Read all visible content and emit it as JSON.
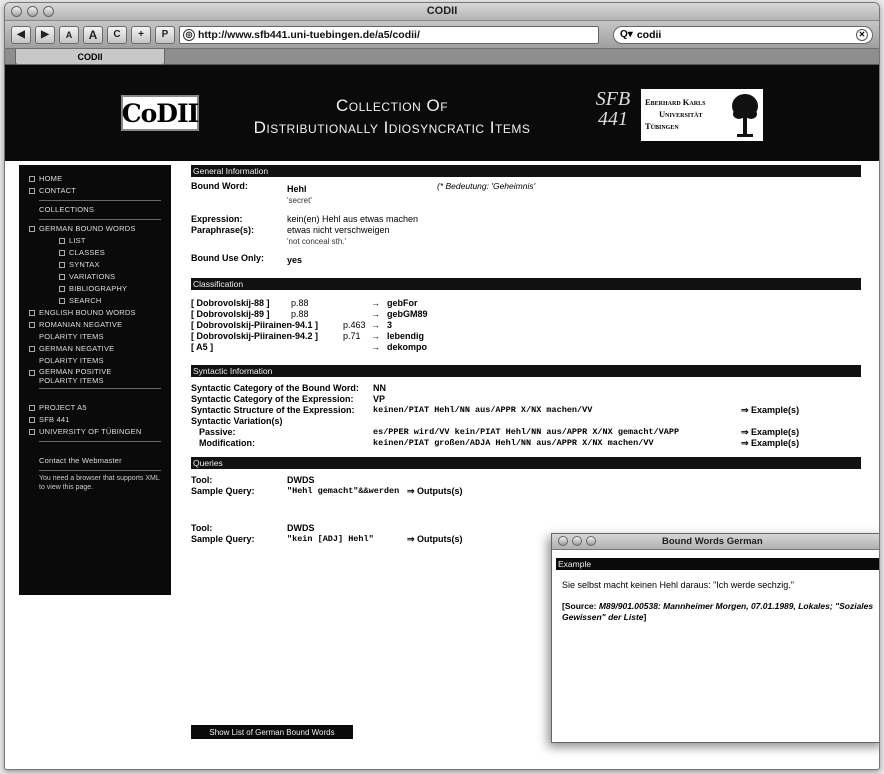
{
  "window": {
    "title": "CODII",
    "tab_label": "CODII"
  },
  "toolbar": {
    "back_label": "◀",
    "forward_label": "▶",
    "text_smaller_label": "A",
    "text_bigger_label": "A",
    "reload_label": "C",
    "add_bookmark_label": "+",
    "snapback_label": "P",
    "url": "http://www.sfb441.uni-tuebingen.de/a5/codii/",
    "search_value": "codii"
  },
  "banner": {
    "logo_text": "CoDII",
    "title_line1": "Collection Of",
    "title_line2": "Distributionally Idiosyncratic Items",
    "sfb_line1": "SFB",
    "sfb_line2": "441",
    "uni_line1": "Eberhard Karls",
    "uni_line2": "Universität",
    "uni_line3": "Tübingen"
  },
  "sidebar": {
    "home": "Home",
    "contact": "Contact",
    "collections": "Collections",
    "german_bound_words": "German Bound Words",
    "sub_items": [
      "List",
      "Classes",
      "Syntax",
      "Variations",
      "Bibliography",
      "Search"
    ],
    "english_bound_words": "English Bound Words",
    "romanian_line1": "Romanian Negative",
    "romanian_line2": "Polarity Items",
    "german_neg_line1": "German Negative",
    "german_neg_line2": "Polarity Items",
    "german_pos_line1": "German Positive",
    "german_pos_line2": "Polarity Items",
    "project": "Project A5",
    "sfb": "SFB 441",
    "university": "University of Tübingen",
    "webmaster": "Contact the Webmaster",
    "xml_note": "You need a browser that supports XML to view this page."
  },
  "general": {
    "header": "General Information",
    "bound_word_label": "Bound Word:",
    "bound_word": "Hehl",
    "bound_word_gloss": "'secret'",
    "bedeutung": "(* Bedeutung: 'Geheimnis'",
    "expression_label": "Expression:",
    "expression": "kein(en) Hehl aus etwas machen",
    "paraphrase_label": "Paraphrase(s):",
    "paraphrase": "etwas nicht verschweigen",
    "paraphrase_gloss": "'not conceal sth.'",
    "bound_use_label": "Bound Use Only:",
    "bound_use": "yes"
  },
  "classification": {
    "header": "Classification",
    "rows": [
      {
        "ref": "[ Dobrovolskij-88 ]",
        "page": "p.88",
        "arrow": "→",
        "value": "gebFor"
      },
      {
        "ref": "[ Dobrovolskij-89 ]",
        "page": "p.88",
        "arrow": "→",
        "value": "gebGM89"
      },
      {
        "ref": "[ Dobrovolskij-Piirainen-94.1 ]",
        "page": "p.463",
        "arrow": "→",
        "value": "3"
      },
      {
        "ref": "[ Dobrovolskij-Piirainen-94.2 ]",
        "page": "p.71",
        "arrow": "→",
        "value": "lebendig"
      },
      {
        "ref": "[ A5 ]",
        "page": "",
        "arrow": "→",
        "value": "dekompo"
      }
    ]
  },
  "syntactic": {
    "header": "Syntactic Information",
    "cat_bound_label": "Syntactic Category of the Bound Word:",
    "cat_bound": "NN",
    "cat_expr_label": "Syntactic Category of the Expression:",
    "cat_expr": "VP",
    "struct_label": "Syntactic Structure of the Expression:",
    "struct": "keinen/PIAT Hehl/NN aus/APPR X/NX machen/VV",
    "examples_label": "⇒ Example(s)",
    "variation_label": "Syntactic Variation(s)",
    "passive_label": "Passive:",
    "passive": "es/PPER wird/VV kein/PIAT Hehl/NN aus/APPR X/NX gemacht/VAPP",
    "modification_label": "Modification:",
    "modification": "keinen/PIAT großen/ADJA Hehl/NN aus/APPR X/NX machen/VV"
  },
  "queries": {
    "header": "Queries",
    "tool_label": "Tool:",
    "sample_label": "Sample Query:",
    "outputs_label": "⇒ Outputs(s)",
    "items": [
      {
        "tool": "DWDS",
        "query": "\"Hehl gemacht\"&&werden"
      },
      {
        "tool": "DWDS",
        "query": "\"kein [ADJ] Hehl\""
      }
    ],
    "show_list_button": "Show List of German Bound Words"
  },
  "popup": {
    "title": "Bound Words German",
    "header": "Example",
    "sentence": "Sie selbst macht keinen Hehl daraus: \"Ich werde sechzig.\"",
    "source_prefix": "[Source: ",
    "source_text": "M89/901.00538: Mannheimer Morgen, 07.01.1989, Lokales; \"Soziales Gewissen\" der Liste",
    "source_suffix": "]"
  }
}
